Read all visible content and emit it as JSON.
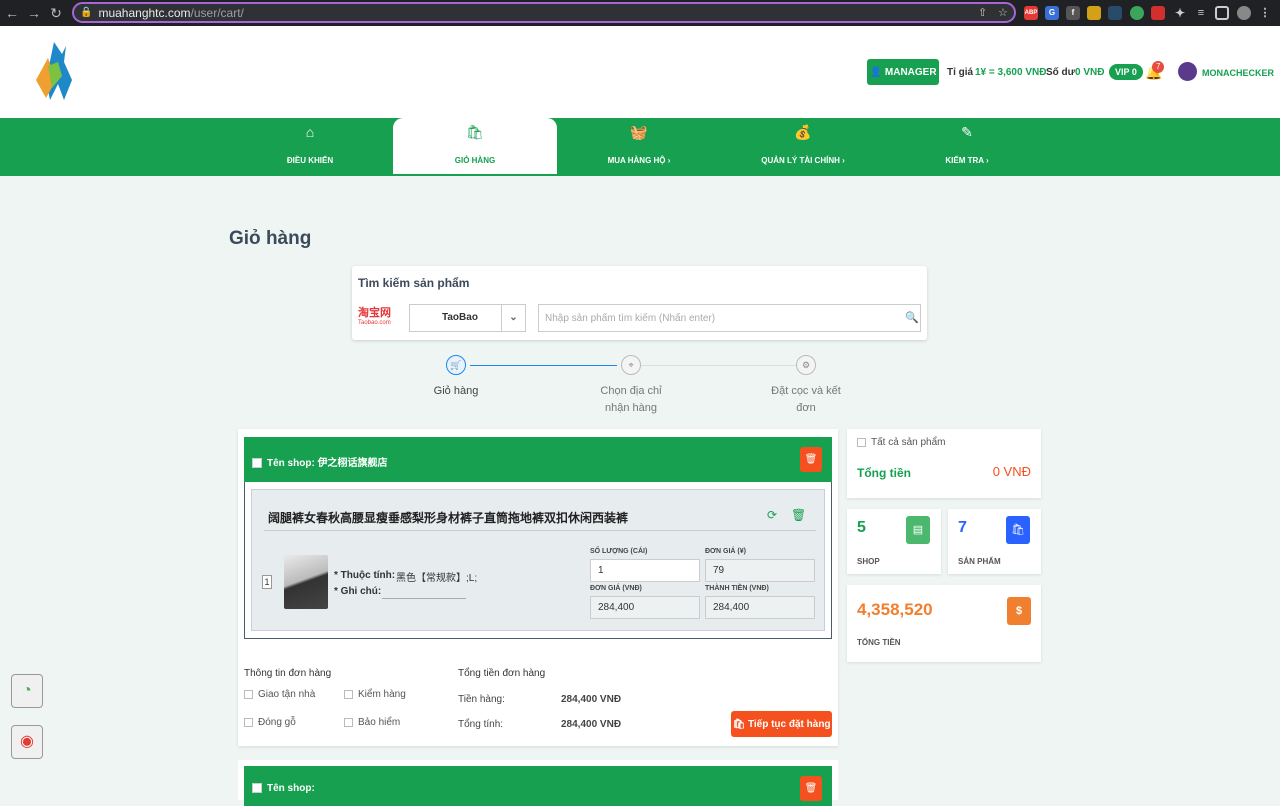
{
  "browser": {
    "url_host": "muahanghtc.com",
    "url_path": "/user/cart/",
    "extensions": [
      "ABP"
    ]
  },
  "header": {
    "manager_label": "MANAGER",
    "rate_label": "Tỉ giá",
    "rate_value": "1¥ = 3,600 VNĐ",
    "balance_label": "Số dư",
    "balance_value": "0 VNĐ",
    "vip": "VIP 0",
    "notifications": "7",
    "username": "MONACHECKER"
  },
  "nav": {
    "items": [
      {
        "label": "ĐIỀU KHIỂN",
        "icon": "home-icon"
      },
      {
        "label": "GIỎ HÀNG",
        "icon": "shopping-bag-icon",
        "active": true
      },
      {
        "label": "MUA HÀNG HỘ",
        "icon": "basket-icon"
      },
      {
        "label": "QUẢN LÝ TÀI CHÍNH",
        "icon": "money-bag-icon"
      },
      {
        "label": "KIỂM TRA",
        "icon": "edit-icon"
      }
    ]
  },
  "page": {
    "title": "Giỏ hàng"
  },
  "search": {
    "title": "Tìm kiếm sản phẩm",
    "site_logo_text": "淘宝网",
    "site_logo_sub": "Taobao.com",
    "site_selected": "TaoBao",
    "placeholder": "Nhập sản phẩm tìm kiếm (Nhấn enter)"
  },
  "steps": [
    {
      "label": "Giỏ hàng",
      "active": true
    },
    {
      "label": "Chọn địa chỉ nhận hàng",
      "active": false
    },
    {
      "label": "Đặt cọc và kết đơn",
      "active": false
    }
  ],
  "shop": {
    "name_label": "Tên shop:",
    "name": "伊之栩话旗舰店",
    "product": {
      "name": "阔腿裤女春秋高腰显瘦垂感梨形身材裤子直筒拖地裤双扣休闲西装裤",
      "index": "1",
      "attr_label": "* Thuộc tính:",
      "attr_value": "黑色【常规款】;L;",
      "note_label": "* Ghi chú:",
      "qty_label": "SỐ LƯỢNG (CÁI)",
      "qty": "1",
      "unit_cny_label": "ĐƠN GIÁ (¥)",
      "unit_cny": "79",
      "unit_vnd_label": "ĐƠN GIÁ (VNĐ)",
      "unit_vnd": "284,400",
      "total_vnd_label": "THÀNH TIỀN (VNĐ)",
      "total_vnd": "284,400"
    },
    "order_info_label": "Thông tin đơn hàng",
    "options": [
      "Giao tận nhà",
      "Kiểm hàng",
      "Đóng gỗ",
      "Bảo hiểm"
    ],
    "order_total_label": "Tổng tiền đơn hàng",
    "goods_label": "Tiền hàng:",
    "goods_value": "284,400 VNĐ",
    "total_label": "Tổng tính:",
    "total_value": "284,400 VNĐ",
    "continue_label": "Tiếp tục đặt hàng"
  },
  "shop2": {
    "name_label": "Tên shop:"
  },
  "summary": {
    "all_products_label": "Tất cả sản phẩm",
    "total_label": "Tổng tiền",
    "total_value": "0 VNĐ",
    "shop_count": "5",
    "shop_label": "SHOP",
    "product_count": "7",
    "product_label": "SẢN PHẨM",
    "grand_total": "4,358,520",
    "grand_total_label": "TỔNG TIỀN",
    "grand_total_icon_text": "$"
  },
  "colors": {
    "brand_green": "#16a050",
    "accent_orange": "#f4511e",
    "blue": "#1e88e5"
  }
}
